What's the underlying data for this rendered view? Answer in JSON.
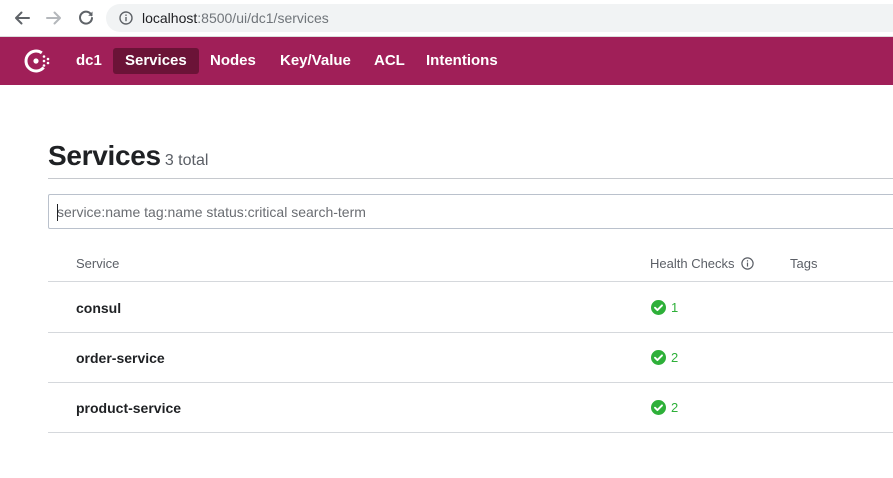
{
  "browser": {
    "url_host": "localhost",
    "url_path": ":8500/ui/dc1/services",
    "icons": [
      "back-arrow-icon",
      "forward-arrow-icon",
      "reload-icon",
      "info-icon"
    ]
  },
  "header": {
    "datacenter": "dc1",
    "nav": {
      "services": "Services",
      "nodes": "Nodes",
      "key_value": "Key/Value",
      "acl": "ACL",
      "intentions": "Intentions"
    },
    "active_nav": "Services",
    "colors": {
      "brand": "#a01f58",
      "active_tab": "#6b1337"
    }
  },
  "main": {
    "title": "Services",
    "count": "3 total",
    "search": {
      "placeholder": "service:name tag:name status:critical search-term",
      "value": ""
    },
    "columns": {
      "service": "Service",
      "health_checks": "Health Checks",
      "tags": "Tags"
    },
    "rows": [
      {
        "name": "consul",
        "health_checks": "1",
        "status": "passing"
      },
      {
        "name": "order-service",
        "health_checks": "2",
        "status": "passing"
      },
      {
        "name": "product-service",
        "health_checks": "2",
        "status": "passing"
      }
    ],
    "colors": {
      "passing": "#2eb039"
    }
  }
}
